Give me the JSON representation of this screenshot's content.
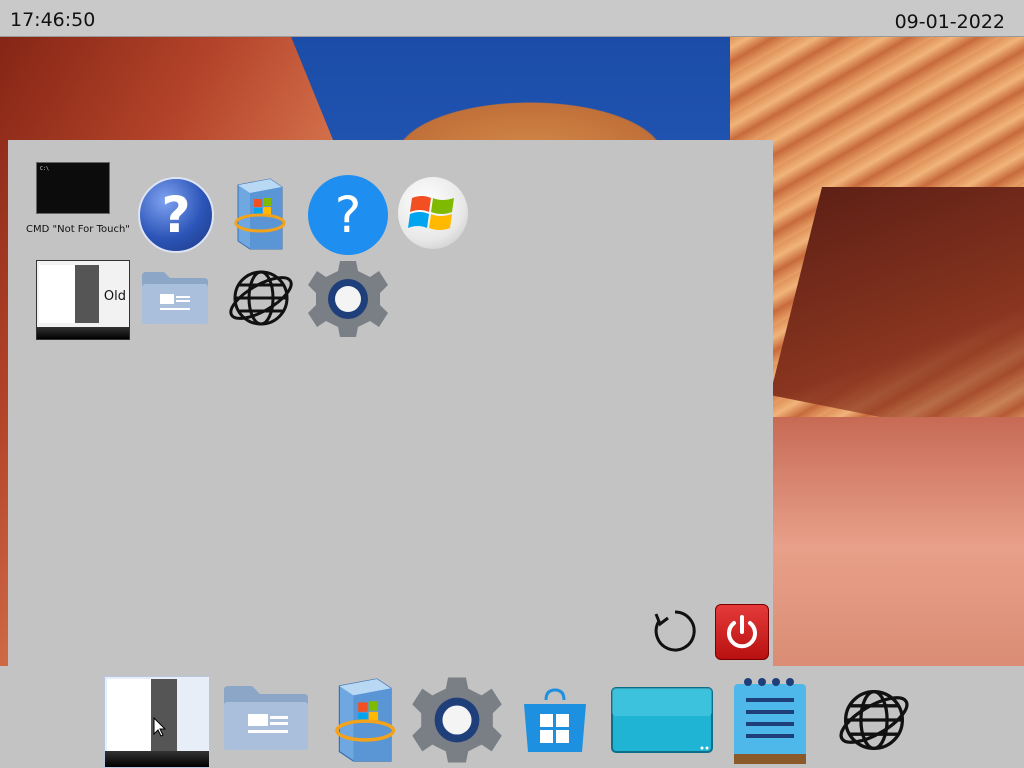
{
  "topbar": {
    "time": "17:46:50",
    "date": "09-01-2022"
  },
  "start_panel": {
    "tiles": [
      {
        "name": "cmd-not-for-touch",
        "label": "CMD \"Not For Touch\"",
        "icon": "terminal-icon"
      },
      {
        "name": "help-classic",
        "icon": "help-icon"
      },
      {
        "name": "windows-installer",
        "icon": "installer-box-icon"
      },
      {
        "name": "help-modern",
        "icon": "question-circle-icon"
      },
      {
        "name": "windows-logo",
        "icon": "windows-logo-icon"
      },
      {
        "name": "old-start-menu",
        "label": "Old",
        "icon": "start-menu-icon"
      },
      {
        "name": "file-explorer",
        "icon": "folder-icon"
      },
      {
        "name": "internet-browser",
        "icon": "globe-icon"
      },
      {
        "name": "settings",
        "icon": "gear-icon"
      }
    ],
    "actions": {
      "refresh_icon": "refresh-icon",
      "power_icon": "power-icon"
    }
  },
  "taskbar": {
    "items": [
      {
        "name": "start-menu",
        "icon": "start-menu-icon"
      },
      {
        "name": "file-explorer",
        "icon": "folder-icon"
      },
      {
        "name": "windows-installer",
        "icon": "installer-box-icon"
      },
      {
        "name": "settings",
        "icon": "gear-icon"
      },
      {
        "name": "store",
        "icon": "store-bag-icon"
      },
      {
        "name": "screen",
        "icon": "display-icon"
      },
      {
        "name": "notepad",
        "icon": "notepad-icon"
      },
      {
        "name": "internet-browser",
        "icon": "globe-icon"
      }
    ]
  },
  "colors": {
    "panel": "#c3c3c3",
    "power_red": "#d42020",
    "help_blue": "#1e8ef0"
  }
}
